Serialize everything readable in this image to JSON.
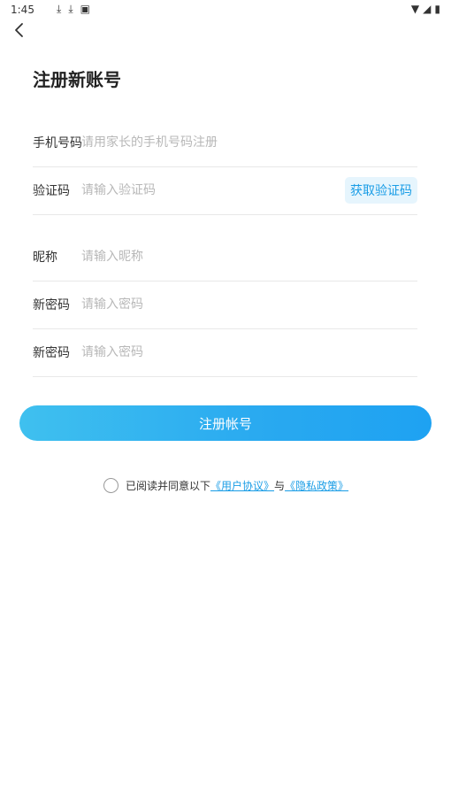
{
  "status_bar": {
    "time": "1:45"
  },
  "page": {
    "title": "注册新账号"
  },
  "form": {
    "phone": {
      "label": "手机号码",
      "placeholder": "请用家长的手机号码注册"
    },
    "code": {
      "label": "验证码",
      "placeholder": "请输入验证码",
      "button": "获取验证码"
    },
    "nickname": {
      "label": "昵称",
      "placeholder": "请输入昵称"
    },
    "password1": {
      "label": "新密码",
      "placeholder": "请输入密码"
    },
    "password2": {
      "label": "新密码",
      "placeholder": "请输入密码"
    }
  },
  "submit": {
    "label": "注册帐号"
  },
  "agreement": {
    "prefix": "已阅读并同意以下",
    "user_agreement": "《用户协议》",
    "joiner": "与",
    "privacy_policy": "《隐私政策》"
  }
}
